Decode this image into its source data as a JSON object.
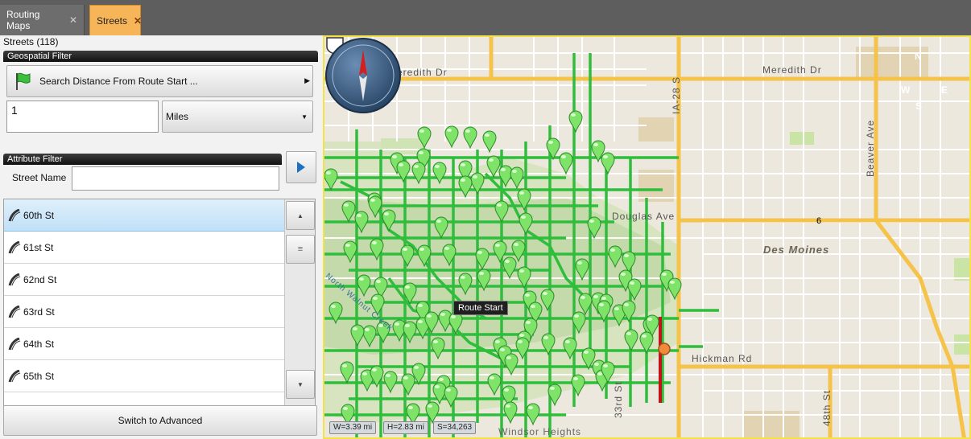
{
  "tabs": [
    {
      "label": "Routing Maps",
      "close": "✕"
    },
    {
      "label": "Streets",
      "close": "✕"
    }
  ],
  "panel": {
    "count_label": "Streets (118)",
    "geo_header": "Geospatial Filter",
    "search_button": "Search Distance From Route Start ...",
    "distance_value": "1",
    "unit_selected": "Miles",
    "attr_header": "Attribute Filter",
    "street_name_label": "Street Name",
    "street_name_value": "",
    "advanced_button": "Switch to Advanced"
  },
  "streets": [
    "60th St",
    "61st St",
    "62nd St",
    "63rd St",
    "64th St",
    "65th St"
  ],
  "map": {
    "labels": {
      "meredith_left": "Meredith Dr",
      "meredith_right": "Meredith Dr",
      "ia28": "IA-28 S",
      "douglas": "Douglas Ave",
      "des_moines": "Des Moines",
      "beaver": "Beaver Ave",
      "hickman": "Hickman Rd",
      "st48": "48th St",
      "st33": "33rd St",
      "route_shield": "6",
      "north_walnut": "North Walnut Creek",
      "heights": "Windsor Heights",
      "route_start": "Route Start"
    },
    "compass": {
      "n": "N",
      "e": "E",
      "s": "S",
      "w": "W"
    },
    "scale": {
      "w": "W=3.39 mi",
      "h": "H=2.83 mi",
      "s": "S=34,263"
    },
    "colors": {
      "highlight": "#2fbd3c",
      "route": "#c0141b",
      "major_road": "#f5c24a",
      "park": "#cfe3b4"
    }
  }
}
